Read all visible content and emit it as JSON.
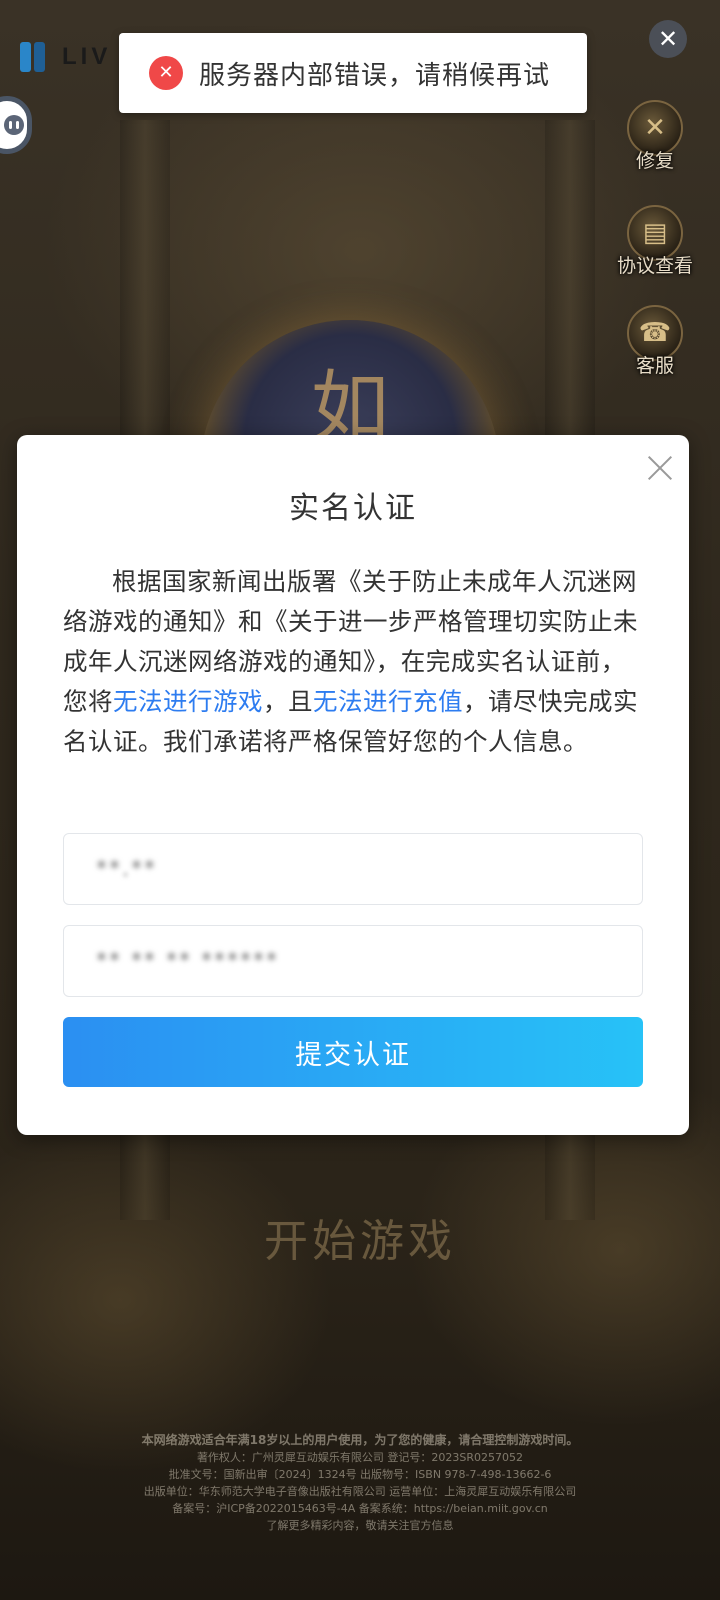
{
  "toast": {
    "icon": "error-icon",
    "message": "服务器内部错误，请稍候再试"
  },
  "header": {
    "logo_text": "LIV"
  },
  "side_menu": [
    {
      "label": "修复",
      "icon": "repair-icon"
    },
    {
      "label": "协议查看",
      "icon": "agreement-icon"
    },
    {
      "label": "客服",
      "icon": "customer-service-icon"
    }
  ],
  "background": {
    "emblem_text": "如",
    "start_button": "开始游戏"
  },
  "modal": {
    "title": "实名认证",
    "body_part1": "根据国家新闻出版署《关于防止未成年人沉迷网络游戏的通知》和《关于进一步严格管理切实防止未成年人沉迷网络游戏的通知》，在完成实名认证前，您将",
    "body_highlight1": "无法进行游戏",
    "body_part2": "，且",
    "body_highlight2": "无法进行充值",
    "body_part3": "，请尽快完成实名认证。我们承诺将严格保管好您的个人信息。",
    "name_value": "**.**",
    "id_value": "** ** ** ******",
    "submit_label": "提交认证"
  },
  "footer": {
    "line1": "本网络游戏适合年满18岁以上的用户使用，为了您的健康，请合理控制游戏时间。",
    "line2": "著作权人：广州灵犀互动娱乐有限公司 登记号：2023SR0257052",
    "line3": "批准文号：国新出审〔2024〕1324号 出版物号：ISBN 978-7-498-13662-6",
    "line4": "出版单位：华东师范大学电子音像出版社有限公司 运营单位：上海灵犀互动娱乐有限公司",
    "line5": "备案号：沪ICP备2022015463号-4A 备案系统：https://beian.miit.gov.cn",
    "line6": "了解更多精彩内容，敬请关注官方信息"
  },
  "colors": {
    "accent": "#2d7cf0",
    "button_start": "#2b8ff2",
    "button_end": "#27c2f7",
    "error": "#f04848"
  }
}
